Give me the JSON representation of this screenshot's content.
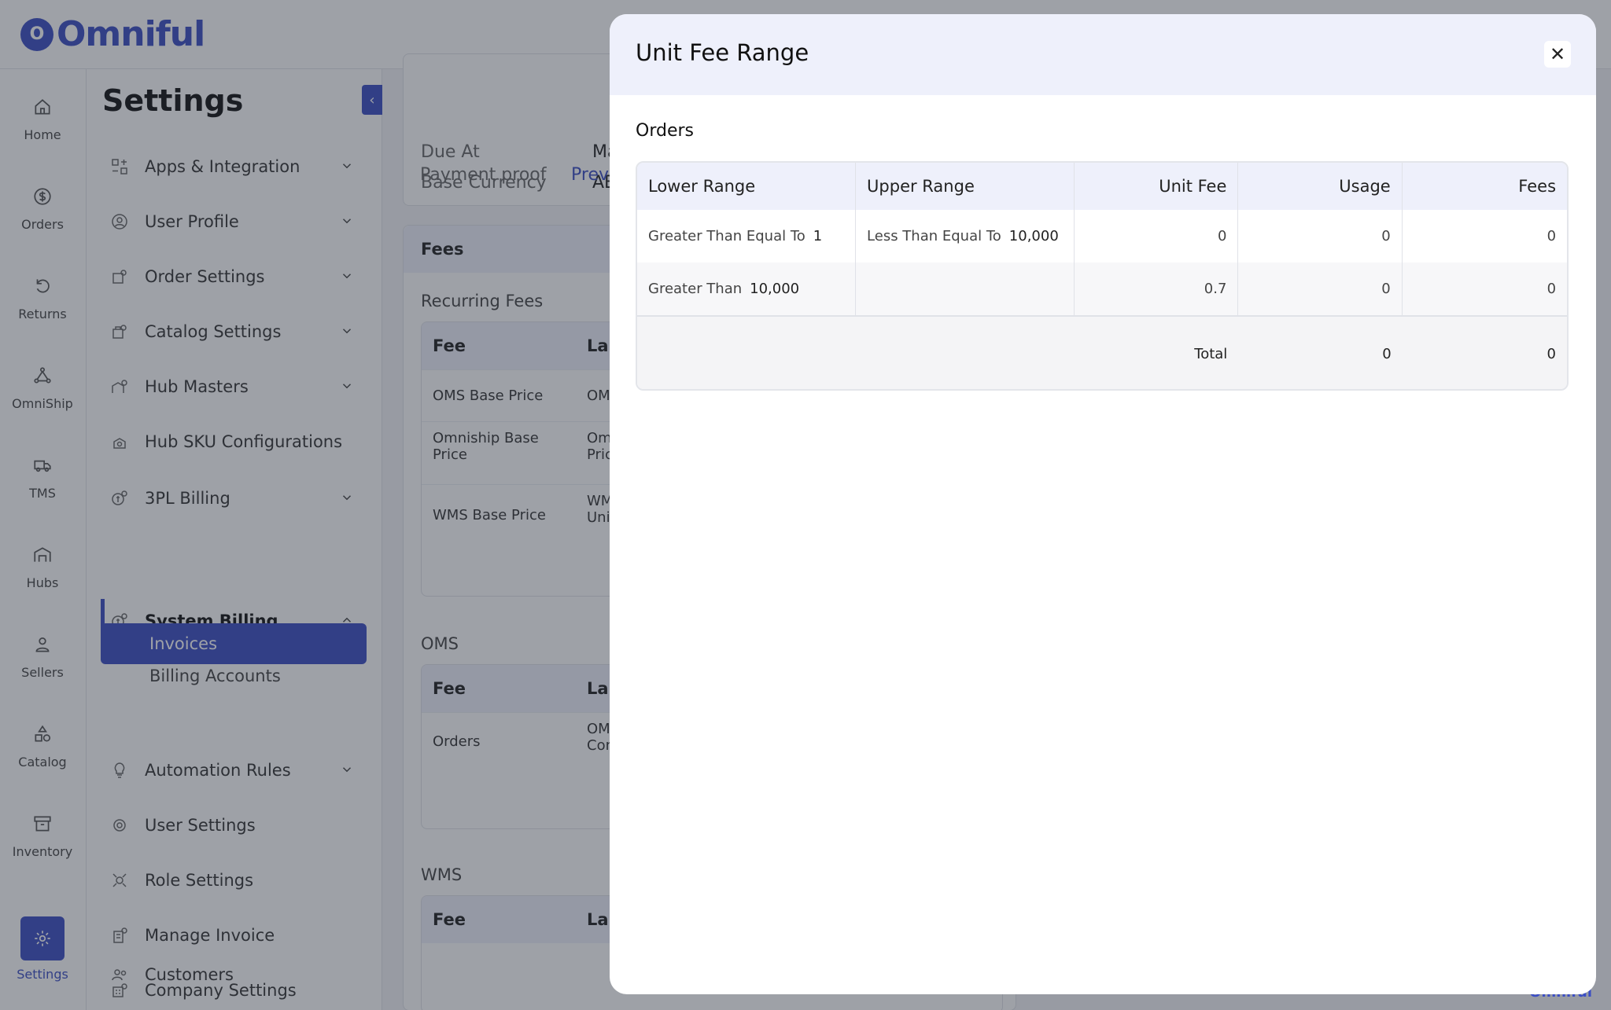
{
  "app": {
    "logo_letter": "O",
    "logo_text": "Omniful",
    "watermark": "Omniful"
  },
  "rail": {
    "items": [
      {
        "label": "Home",
        "icon": "home-icon"
      },
      {
        "label": "Orders",
        "icon": "dollar-icon"
      },
      {
        "label": "Returns",
        "icon": "return-icon"
      },
      {
        "label": "OmniShip",
        "icon": "omniship-icon"
      },
      {
        "label": "TMS",
        "icon": "truck-icon"
      },
      {
        "label": "Hubs",
        "icon": "warehouse-icon"
      },
      {
        "label": "Sellers",
        "icon": "user-icon"
      },
      {
        "label": "Catalog",
        "icon": "shapes-icon"
      },
      {
        "label": "Inventory",
        "icon": "box-icon"
      },
      {
        "label": "Settings",
        "icon": "gear-icon",
        "active": true
      }
    ]
  },
  "settings": {
    "title": "Settings",
    "collapse_glyph": "‹",
    "items": [
      {
        "label": "Apps & Integration"
      },
      {
        "label": "User Profile"
      },
      {
        "label": "Order Settings"
      },
      {
        "label": "Catalog Settings"
      },
      {
        "label": "Hub Masters"
      },
      {
        "label": "Hub SKU Configurations"
      },
      {
        "label": "3PL Billing"
      },
      {
        "label": "System Billing"
      },
      {
        "label": "Automation Rules"
      },
      {
        "label": "User Settings"
      },
      {
        "label": "Role Settings"
      },
      {
        "label": "Manage Invoice"
      },
      {
        "label": "Company Settings"
      },
      {
        "label": "Customers"
      }
    ],
    "sub_items": [
      {
        "label": "Billing Accounts"
      },
      {
        "label": "Invoices",
        "active": true
      }
    ]
  },
  "invoice": {
    "due_at_label": "Due At",
    "due_at_value": "May",
    "currency_label": "Base Currency",
    "currency_value": "AED",
    "payment_label": "Payment proof",
    "payment_value": "Previ",
    "fees_title": "Fees",
    "recurring_title": "Recurring Fees",
    "fee_col": "Fee",
    "label_col": "Lab",
    "recurring_rows": [
      {
        "fee": "OMS Base Price",
        "label": "OMS"
      },
      {
        "fee": "Omniship Base Price",
        "label": "Om Pric"
      },
      {
        "fee": "WMS Base Price",
        "label": "WM Unit"
      }
    ],
    "oms_title": "OMS",
    "oms_rows": [
      {
        "fee": "Orders",
        "label": "OMS Con"
      }
    ],
    "wms_title": "WMS"
  },
  "modal": {
    "title": "Unit Fee Range",
    "close_glyph": "✕",
    "section": "Orders",
    "headers": [
      "Lower Range",
      "Upper Range",
      "Unit Fee",
      "Usage",
      "Fees"
    ],
    "rows": [
      {
        "lower_label": "Greater Than Equal To",
        "lower_value": "1",
        "upper_label": "Less Than Equal To",
        "upper_value": "10,000",
        "unit_fee": "0",
        "usage": "0",
        "fees": "0"
      },
      {
        "lower_label": "Greater Than",
        "lower_value": "10,000",
        "upper_label": "",
        "upper_value": "",
        "unit_fee": "0.7",
        "usage": "0",
        "fees": "0"
      }
    ],
    "total": {
      "label": "Total",
      "usage": "0",
      "fees": "0"
    }
  }
}
